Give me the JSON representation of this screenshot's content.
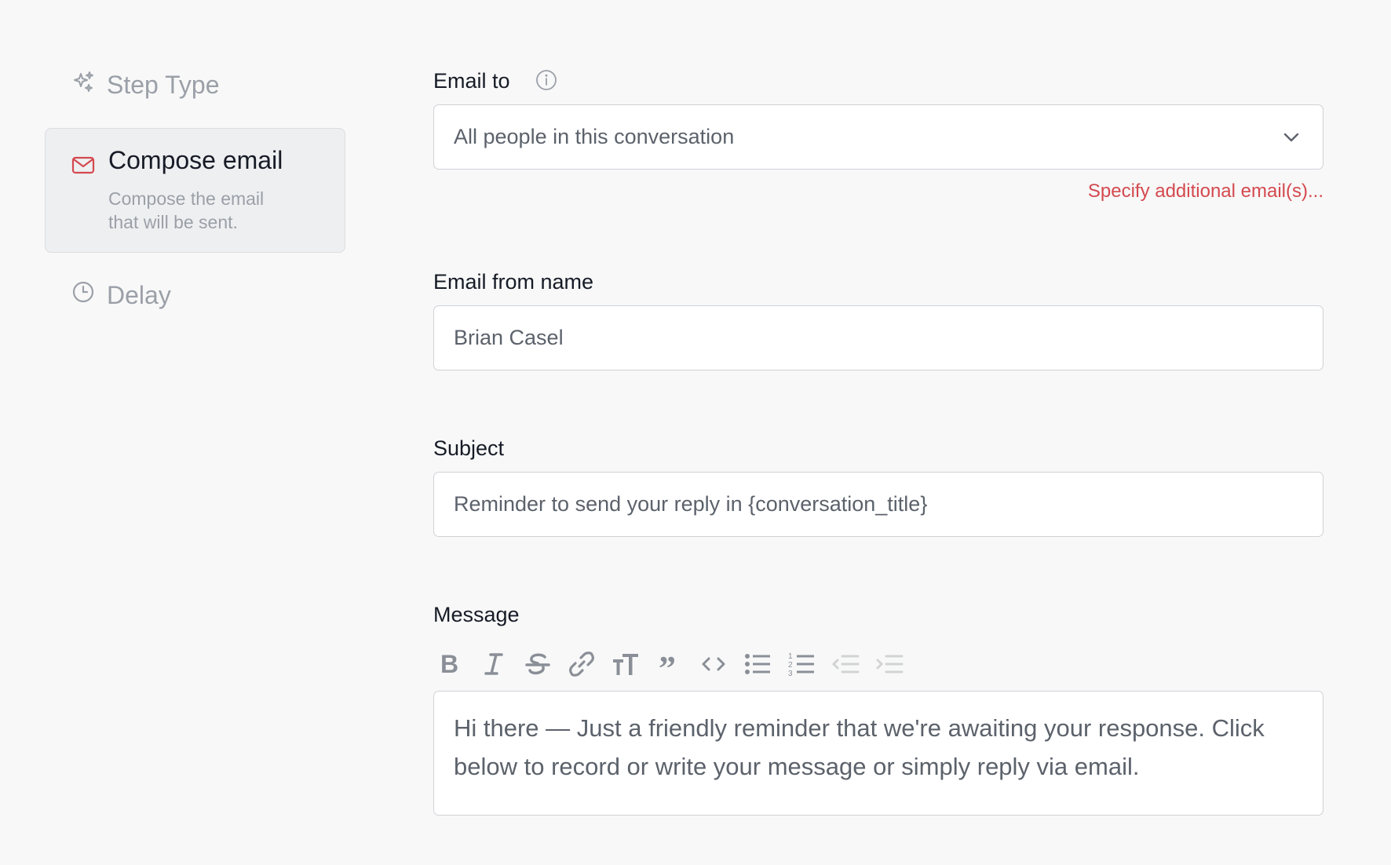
{
  "sidebar": {
    "step_type": "Step Type",
    "compose": {
      "title": "Compose email",
      "description": "Compose the email that will be sent."
    },
    "delay": "Delay"
  },
  "form": {
    "email_to": {
      "label": "Email to",
      "value": "All people in this conversation",
      "link": "Specify additional email(s)..."
    },
    "email_from_name": {
      "label": "Email from name",
      "value": "Brian Casel"
    },
    "subject": {
      "label": "Subject",
      "value": "Reminder to send your reply in {conversation_title}"
    },
    "message": {
      "label": "Message",
      "value": "Hi there — Just a friendly reminder that we're awaiting your response. Click below to record or write your message or simply reply via email."
    }
  },
  "toolbar": {
    "icons": [
      "bold-icon",
      "italic-icon",
      "strikethrough-icon",
      "link-icon",
      "heading-icon",
      "quote-icon",
      "code-icon",
      "bullet-list-icon",
      "numbered-list-icon",
      "outdent-icon",
      "indent-icon"
    ]
  },
  "colors": {
    "accent_red": "#d4494f",
    "muted_text": "#9ba0a8",
    "border": "#cfd2d6"
  }
}
